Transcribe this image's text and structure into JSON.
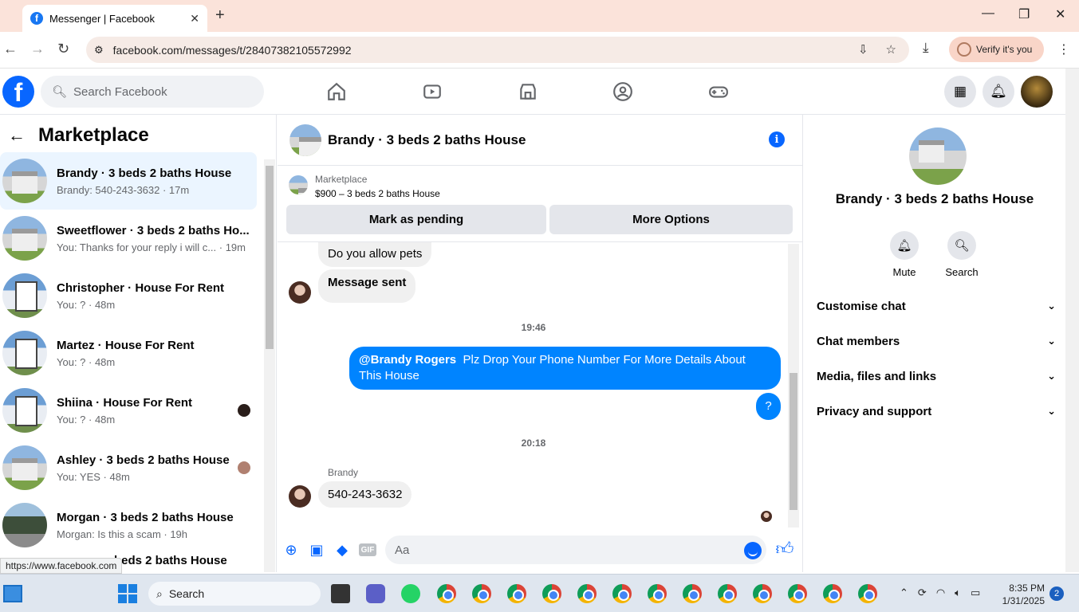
{
  "browser": {
    "tab_title": "Messenger | Facebook",
    "url": "facebook.com/messages/t/28407382105572992",
    "verify_label": "Verify it's you",
    "status_url": "https://www.facebook.com"
  },
  "fb_header": {
    "search_placeholder": "Search Facebook"
  },
  "left_panel": {
    "title": "Marketplace",
    "conversations": [
      {
        "name": "Brandy · 3 beds 2 baths House",
        "snippet": "Brandy: 540-243-3632 · 17m"
      },
      {
        "name": "Sweetflower · 3 beds 2 baths Ho...",
        "snippet": "You: Thanks for your reply i will c... · 19m"
      },
      {
        "name": "Christopher · House For Rent",
        "snippet": "You: ? · 48m"
      },
      {
        "name": "Martez · House For Rent",
        "snippet": "You: ? · 48m"
      },
      {
        "name": "Shiina · House For Rent",
        "snippet": "You: ? · 48m"
      },
      {
        "name": "Ashley · 3 beds 2 baths House",
        "snippet": "You: YES · 48m"
      },
      {
        "name": "Morgan · 3 beds 2 baths House",
        "snippet": "Morgan: Is this a scam · 19h"
      },
      {
        "name": "beds 2 baths House",
        "snippet": ""
      }
    ]
  },
  "chat": {
    "title": "Brandy · 3 beds 2 baths House",
    "listing_source": "Marketplace",
    "listing_price": "$900 – 3 beds 2 baths House",
    "mark_pending": "Mark as pending",
    "more_options": "More Options",
    "messages": {
      "m1": "Do you allow pets",
      "m2": "Message sent",
      "time1": "19:46",
      "out_mention": "@Brandy Rogers",
      "out_text": "Plz Drop Your Phone Number For More Details About This House",
      "out_q": "?",
      "time2": "20:18",
      "sender": "Brandy",
      "m3": "540-243-3632"
    },
    "composer_placeholder": "Aa",
    "gif_label": "GIF"
  },
  "right_panel": {
    "name": "Brandy · 3 beds 2 baths House",
    "mute": "Mute",
    "search": "Search",
    "sections": [
      "Customise chat",
      "Chat members",
      "Media, files and links",
      "Privacy and support"
    ]
  },
  "taskbar": {
    "search": "Search",
    "time": "8:35 PM",
    "date": "1/31/2025",
    "notifications": "2"
  }
}
